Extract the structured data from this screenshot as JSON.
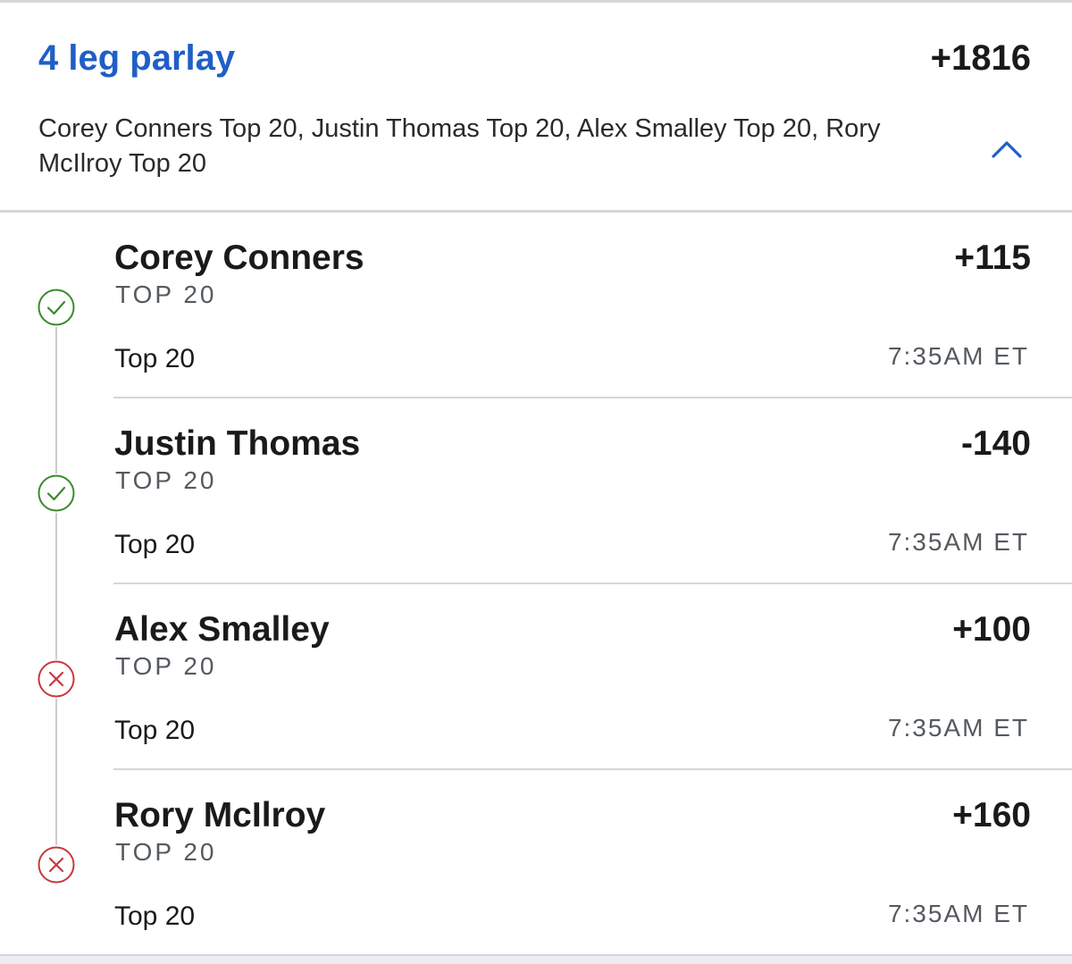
{
  "parlay": {
    "title": "4 leg parlay",
    "odds": "+1816",
    "summary": "Corey Conners Top 20, Justin Thomas Top 20, Alex Smalley Top 20, Rory McIlroy Top 20",
    "collapse_icon": "chevron-up-icon",
    "accent_color": "#1f5fc6"
  },
  "legs": [
    {
      "player": "Corey Conners",
      "odds": "+115",
      "market": "TOP 20",
      "selection": "Top 20",
      "time": "7:35AM ET",
      "status": "won",
      "status_icon": "check-circle-icon",
      "status_color": "#3a8a2c"
    },
    {
      "player": "Justin Thomas",
      "odds": "-140",
      "market": "TOP 20",
      "selection": "Top 20",
      "time": "7:35AM ET",
      "status": "won",
      "status_icon": "check-circle-icon",
      "status_color": "#3a8a2c"
    },
    {
      "player": "Alex Smalley",
      "odds": "+100",
      "market": "TOP 20",
      "selection": "Top 20",
      "time": "7:35AM ET",
      "status": "lost",
      "status_icon": "x-circle-icon",
      "status_color": "#c9373f"
    },
    {
      "player": "Rory McIlroy",
      "odds": "+160",
      "market": "TOP 20",
      "selection": "Top 20",
      "time": "7:35AM ET",
      "status": "lost",
      "status_icon": "x-circle-icon",
      "status_color": "#c9373f"
    }
  ]
}
